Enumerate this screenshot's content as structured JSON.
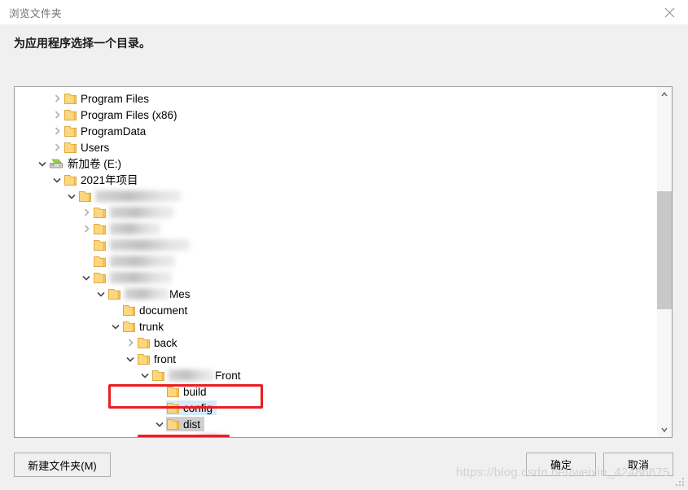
{
  "window": {
    "title": "浏览文件夹",
    "close_icon": "close-icon"
  },
  "prompt": "为应用程序选择一个目录。",
  "tree": {
    "items": [
      {
        "label": "Program Files",
        "indent": 2,
        "state": "collapsed",
        "icon": "folder-icon",
        "redacted": false,
        "highlight": "none"
      },
      {
        "label": "Program Files (x86)",
        "indent": 2,
        "state": "collapsed",
        "icon": "folder-icon",
        "redacted": false,
        "highlight": "none"
      },
      {
        "label": "ProgramData",
        "indent": 2,
        "state": "collapsed",
        "icon": "folder-icon",
        "redacted": false,
        "highlight": "none"
      },
      {
        "label": "Users",
        "indent": 2,
        "state": "collapsed",
        "icon": "folder-icon",
        "redacted": false,
        "highlight": "none"
      },
      {
        "label": "新加卷 (E:)",
        "indent": 1,
        "state": "expanded",
        "icon": "drive-icon",
        "redacted": false,
        "highlight": "none"
      },
      {
        "label": "2021年项目",
        "indent": 2,
        "state": "expanded",
        "icon": "folder-icon",
        "redacted": false,
        "highlight": "none"
      },
      {
        "label": "",
        "indent": 3,
        "state": "expanded",
        "icon": "folder-icon",
        "redacted": true,
        "redacted_width": 105,
        "highlight": "none"
      },
      {
        "label": "",
        "indent": 4,
        "state": "collapsed",
        "icon": "folder-icon",
        "redacted": true,
        "redacted_width": 78,
        "highlight": "none"
      },
      {
        "label": "",
        "indent": 4,
        "state": "collapsed",
        "icon": "folder-icon",
        "redacted": true,
        "redacted_width": 62,
        "highlight": "none"
      },
      {
        "label": "",
        "indent": 4,
        "state": "leaf",
        "icon": "folder-icon",
        "redacted": true,
        "redacted_width": 98,
        "highlight": "none"
      },
      {
        "label": "",
        "indent": 4,
        "state": "leaf",
        "icon": "folder-icon",
        "redacted": true,
        "redacted_width": 80,
        "highlight": "none"
      },
      {
        "label": "",
        "indent": 4,
        "state": "expanded",
        "icon": "folder-icon",
        "redacted": true,
        "redacted_width": 76,
        "highlight": "none"
      },
      {
        "label": "Mes",
        "indent": 5,
        "state": "expanded",
        "icon": "folder-icon",
        "redacted": true,
        "redacted_width": 54,
        "highlight": "none"
      },
      {
        "label": "document",
        "indent": 6,
        "state": "leaf",
        "icon": "folder-icon",
        "redacted": false,
        "highlight": "none"
      },
      {
        "label": "trunk",
        "indent": 6,
        "state": "expanded",
        "icon": "folder-icon",
        "redacted": false,
        "highlight": "none"
      },
      {
        "label": "back",
        "indent": 7,
        "state": "collapsed",
        "icon": "folder-icon",
        "redacted": false,
        "highlight": "none"
      },
      {
        "label": "front",
        "indent": 7,
        "state": "expanded",
        "icon": "folder-icon",
        "redacted": false,
        "highlight": "none"
      },
      {
        "label": "Front",
        "indent": 8,
        "state": "expanded",
        "icon": "folder-icon",
        "redacted": true,
        "redacted_width": 56,
        "highlight": "none"
      },
      {
        "label": "build",
        "indent": 9,
        "state": "leaf",
        "icon": "folder-icon",
        "redacted": false,
        "highlight": "none"
      },
      {
        "label": "config",
        "indent": 9,
        "state": "leaf",
        "icon": "folder-icon",
        "redacted": false,
        "highlight": "hover"
      },
      {
        "label": "dist",
        "indent": 9,
        "state": "expanded",
        "icon": "folder-icon",
        "redacted": false,
        "highlight": "selected"
      },
      {
        "label": "",
        "indent": 10,
        "state": "leaf",
        "icon": "folder-icon",
        "redacted": true,
        "redacted_width": 40,
        "highlight": "none"
      }
    ]
  },
  "scrollbar": {
    "up_icon": "chevron-up-icon",
    "down_icon": "chevron-down-icon"
  },
  "annotations": {
    "box_color": "#ec1c24",
    "boxes": [
      {
        "target": "Front"
      },
      {
        "target": "dist"
      }
    ]
  },
  "buttons": {
    "new_folder": "新建文件夹(M)",
    "ok": "确定",
    "cancel": "取消"
  },
  "watermark": "https://blog.csdn.net/weixin_42486675"
}
